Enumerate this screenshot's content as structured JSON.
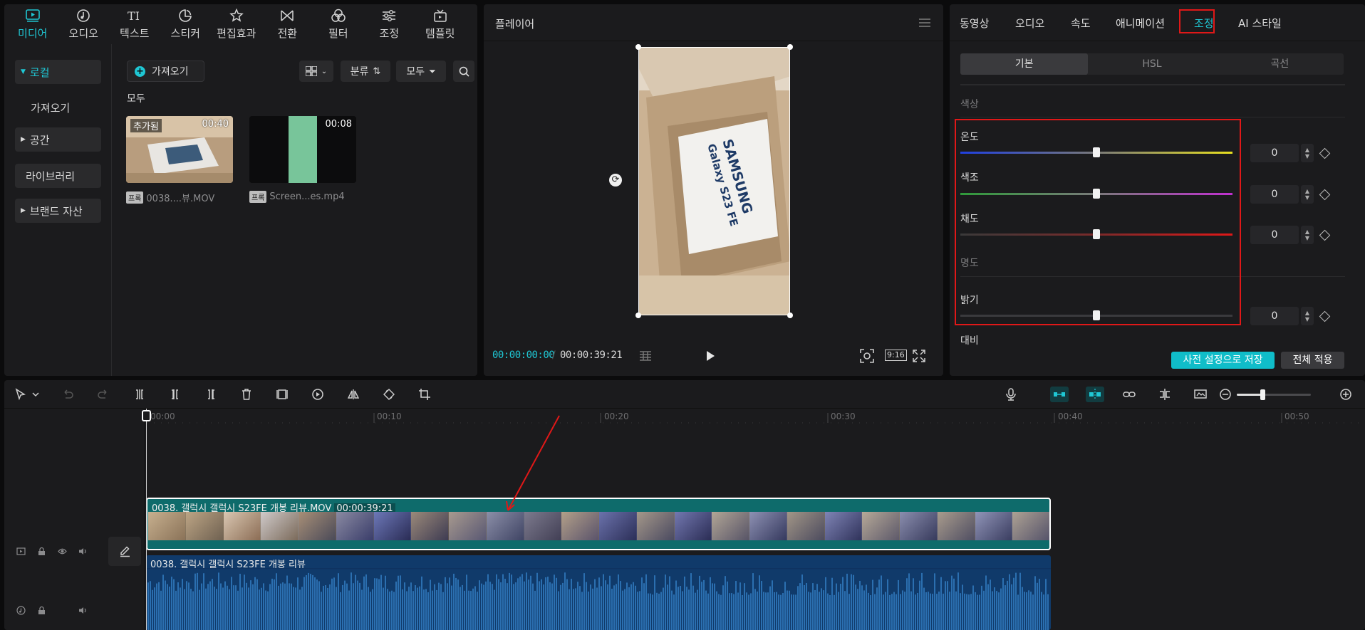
{
  "top_tabs": [
    {
      "label": "미디어",
      "icon": "media-icon",
      "active": true
    },
    {
      "label": "오디오",
      "icon": "audio-icon"
    },
    {
      "label": "텍스트",
      "icon": "text-icon"
    },
    {
      "label": "스티커",
      "icon": "sticker-icon"
    },
    {
      "label": "편집효과",
      "icon": "effects-icon"
    },
    {
      "label": "전환",
      "icon": "transition-icon"
    },
    {
      "label": "필터",
      "icon": "filter-icon"
    },
    {
      "label": "조정",
      "icon": "adjust-icon"
    },
    {
      "label": "템플릿",
      "icon": "template-icon"
    }
  ],
  "left_nav": {
    "local": "로컬",
    "import": "가져오기",
    "space": "공간",
    "library": "라이브러리",
    "brand_assets": "브랜드 자산"
  },
  "media": {
    "import_label": "가져오기",
    "sort_label": "분류",
    "filter_label": "모두",
    "section": "모두",
    "items": [
      {
        "badge": "추가됨",
        "duration": "00:40",
        "tag": "프록",
        "name": "0038....뷰.MOV"
      },
      {
        "badge": "",
        "duration": "00:08",
        "tag": "프록",
        "name": "Screen...es.mp4"
      }
    ]
  },
  "player": {
    "title": "플레이어",
    "current_time": "00:00:00:00",
    "total_time": "00:00:39:21",
    "aspect_ratio": "9:16",
    "box_text_brand": "SAMSUNG",
    "box_text_model": "Galaxy S23 FE"
  },
  "inspector": {
    "tabs": [
      "동영상",
      "오디오",
      "속도",
      "애니메이션",
      "조정",
      "AI 스타일"
    ],
    "active_tab": "조정",
    "subtabs": [
      "기본",
      "HSL",
      "곡선"
    ],
    "category_color": "색상",
    "category_light": "명도",
    "params": [
      {
        "label": "온도",
        "value": "0",
        "level": 0.5
      },
      {
        "label": "색조",
        "value": "0",
        "level": 0.5
      },
      {
        "label": "채도",
        "value": "0",
        "level": 0.5
      },
      {
        "label": "밝기",
        "value": "0",
        "level": 0.5
      }
    ],
    "next_param": "대비",
    "save_preset": "사전 설정으로 저장",
    "apply_all": "전체 적용"
  },
  "timeline": {
    "ruler": [
      "00:00",
      "00:10",
      "00:20",
      "00:30",
      "00:40",
      "00:50"
    ],
    "video_clip_name": "0038. 갤럭시 갤럭시 S23FE 개봉 리뷰.MOV",
    "video_clip_duration": "00:00:39:21",
    "audio_clip_name": "0038. 갤럭시 갤럭시 S23FE 개봉 리뷰"
  },
  "colors": {
    "accent": "#1fc7d4",
    "highlight_red": "#e01818",
    "video_clip": "#0e6b6b",
    "audio_clip": "#103a6a"
  }
}
